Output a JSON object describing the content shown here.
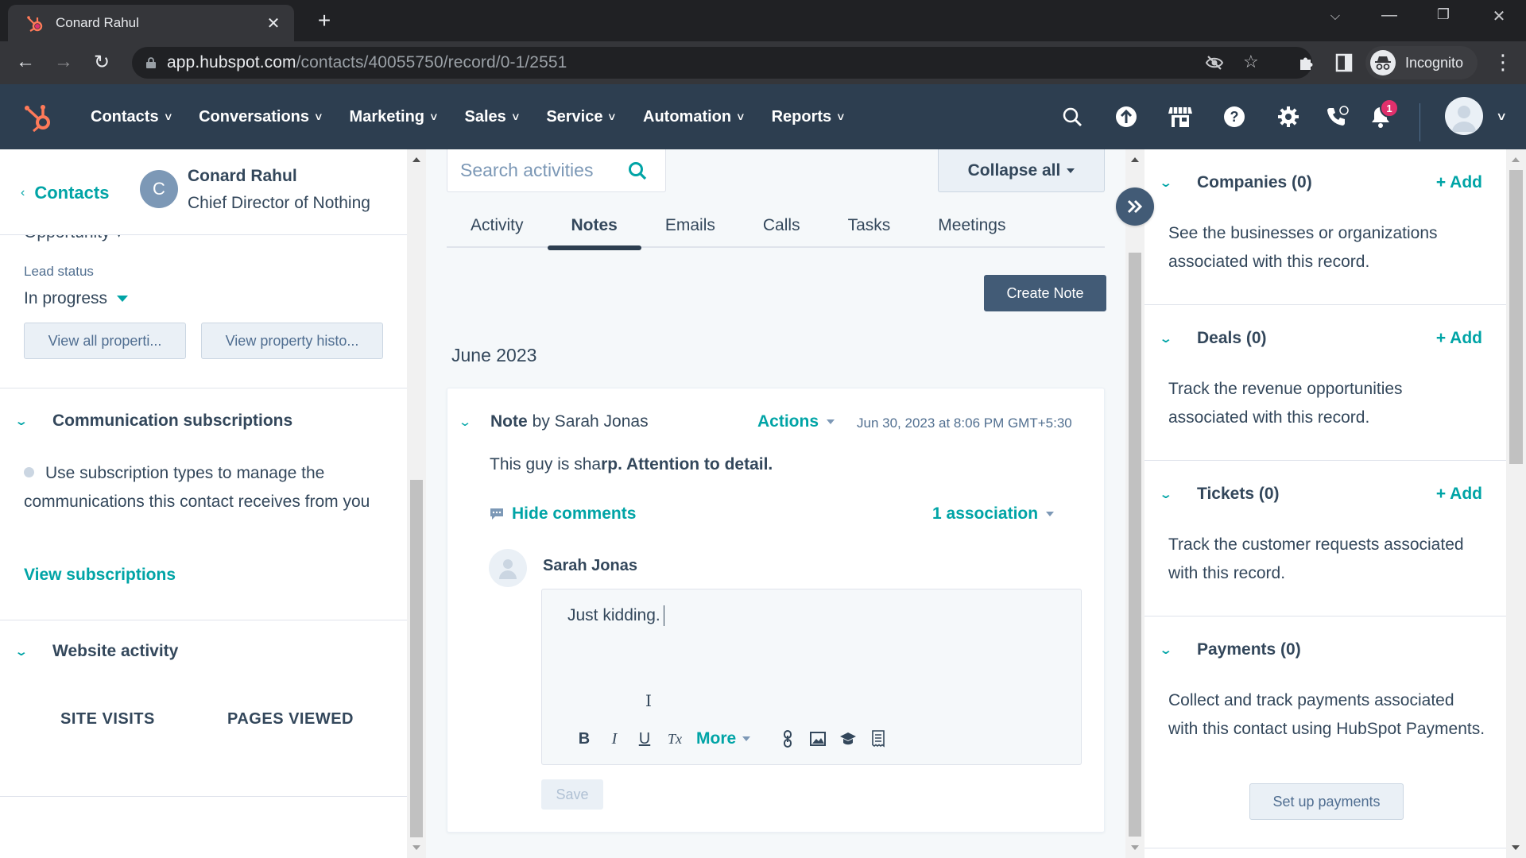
{
  "browser": {
    "tab_title": "Conard Rahul",
    "url_host": "app.hubspot.com",
    "url_path": "/contacts/40055750/record/0-1/2551",
    "profile_label": "Incognito"
  },
  "nav": {
    "menu": [
      {
        "label": "Contacts"
      },
      {
        "label": "Conversations"
      },
      {
        "label": "Marketing"
      },
      {
        "label": "Sales"
      },
      {
        "label": "Service"
      },
      {
        "label": "Automation"
      },
      {
        "label": "Reports"
      }
    ],
    "notification_count": "1"
  },
  "left": {
    "back_label": "Contacts",
    "contact": {
      "initial": "C",
      "name": "Conard Rahul",
      "title": "Chief Director of Nothing"
    },
    "lifecycle_peek": "Opportunity",
    "lead_status_label": "Lead status",
    "lead_status_value": "In progress",
    "view_all_properties": "View all properti...",
    "view_property_history": "View property histo...",
    "comm_subs": {
      "title": "Communication subscriptions",
      "text": "Use subscription types to manage the communications this contact receives from you",
      "link": "View subscriptions"
    },
    "website_activity": {
      "title": "Website activity",
      "stats": [
        "SITE VISITS",
        "PAGES VIEWED"
      ]
    }
  },
  "timeline": {
    "search_placeholder": "Search activities",
    "collapse_label": "Collapse all",
    "tabs": [
      {
        "label": "Activity",
        "active": false
      },
      {
        "label": "Notes",
        "active": true
      },
      {
        "label": "Emails",
        "active": false
      },
      {
        "label": "Calls",
        "active": false
      },
      {
        "label": "Tasks",
        "active": false
      },
      {
        "label": "Meetings",
        "active": false
      }
    ],
    "create_note_label": "Create Note",
    "month": "June 2023",
    "note": {
      "type_label": "Note",
      "by_text": "by Sarah Jonas",
      "actions_label": "Actions",
      "date": "Jun 30, 2023 at 8:06 PM GMT+5:30",
      "body_plain": "This guy is sha",
      "body_bold": "rp. Attention to detail.",
      "hide_comments_label": "Hide comments",
      "association_label": "1 association",
      "comment": {
        "author": "Sarah Jonas",
        "draft_text": "Just kidding.",
        "toolbar": {
          "bold": "B",
          "italic": "I",
          "underline": "U",
          "clear_format": "Tx",
          "more": "More"
        },
        "save_label": "Save"
      }
    }
  },
  "sidebar": {
    "cards": [
      {
        "title": "Companies (0)",
        "add": "+ Add",
        "desc": "See the businesses or organizations associated with this record."
      },
      {
        "title": "Deals (0)",
        "add": "+ Add",
        "desc": "Track the revenue opportunities associated with this record."
      },
      {
        "title": "Tickets (0)",
        "add": "+ Add",
        "desc": "Track the customer requests associated with this record."
      },
      {
        "title": "Payments (0)",
        "desc": "Collect and track payments associated with this contact using HubSpot Payments.",
        "button": "Set up payments"
      }
    ]
  },
  "colors": {
    "nav_bg": "#2d3e50",
    "accent_teal": "#00a4a6",
    "primary_button": "#425b76",
    "hubspot_orange": "#ff7a59",
    "badge_pink": "#e0306c"
  }
}
